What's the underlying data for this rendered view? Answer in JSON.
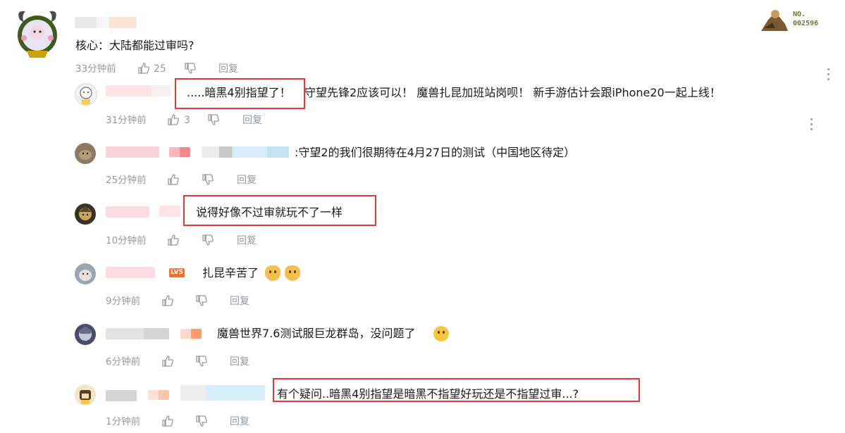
{
  "main_comment": {
    "text": "核心：大陆都能过审吗?",
    "time": "33分钟前",
    "likes": "25",
    "reply_label": "回复",
    "badge": {
      "prefix": "NO.",
      "number": "002596"
    }
  },
  "replies": [
    {
      "text_highlight": ".....暗黑4别指望了！",
      "text_rest": "守望先锋2应该可以！ 魔兽扎昆加班站岗呗！ 新手游估计会跟iPhone20一起上线！",
      "time": "31分钟前",
      "likes": "3",
      "reply_label": "回复"
    },
    {
      "text": ":守望2的我们很期待在4月27日的测试（中国地区待定）",
      "time": "25分钟前",
      "likes": "",
      "reply_label": "回复"
    },
    {
      "text": "说得好像不过审就玩不了一样",
      "time": "10分钟前",
      "likes": "",
      "reply_label": "回复"
    },
    {
      "text": "扎昆辛苦了",
      "time": "9分钟前",
      "likes": "",
      "reply_label": "回复",
      "level": "LV5"
    },
    {
      "text": "魔兽世界7.6测试服巨龙群岛，没问题了",
      "time": "6分钟前",
      "likes": "",
      "reply_label": "回复"
    },
    {
      "text": "有个疑问..暗黑4别指望是暗黑不指望好玩还是不指望过审...?",
      "time": "1分钟前",
      "likes": "",
      "reply_label": "回复"
    }
  ],
  "colors": {
    "highlight_box": "#e53935",
    "meta_text": "#9499a0",
    "level_badge": "#ff6a2b"
  }
}
